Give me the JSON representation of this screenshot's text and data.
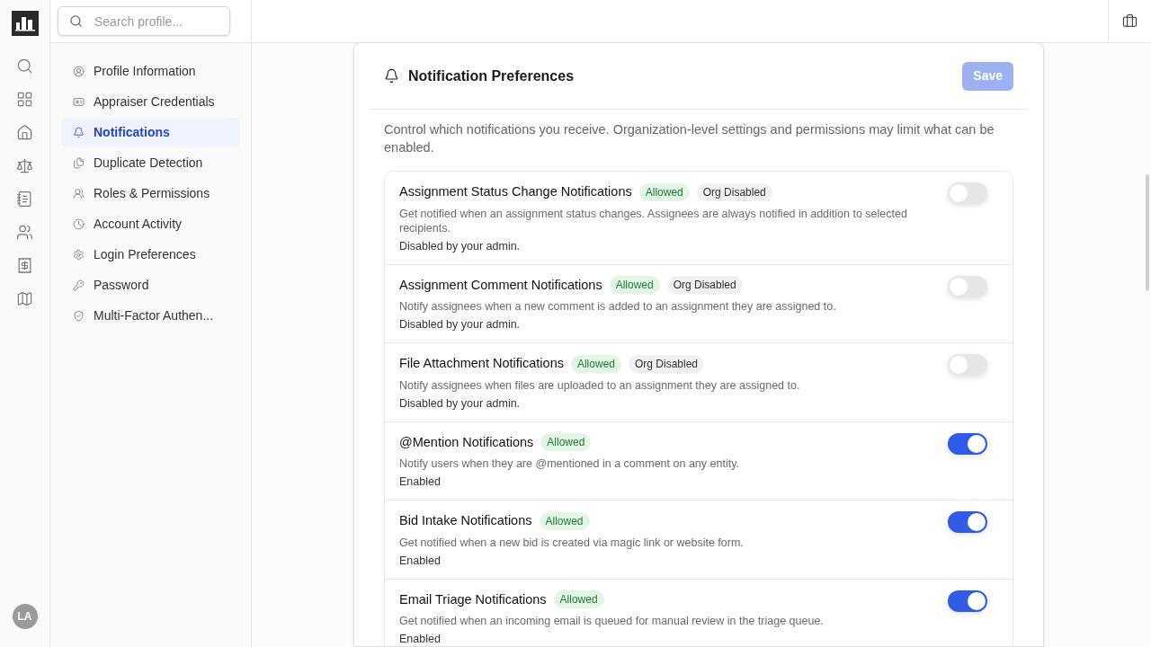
{
  "search": {
    "placeholder": "Search profile..."
  },
  "avatar": {
    "initials": "LA"
  },
  "nav": [
    {
      "label": "Profile Information",
      "selected": false
    },
    {
      "label": "Appraiser Credentials",
      "selected": false
    },
    {
      "label": "Notifications",
      "selected": true
    },
    {
      "label": "Duplicate Detection",
      "selected": false
    },
    {
      "label": "Roles & Permissions",
      "selected": false
    },
    {
      "label": "Account Activity",
      "selected": false
    },
    {
      "label": "Login Preferences",
      "selected": false
    },
    {
      "label": "Password",
      "selected": false
    },
    {
      "label": "Multi-Factor Authen...",
      "selected": false
    }
  ],
  "panel": {
    "title": "Notification Preferences",
    "save": {
      "label": "Save",
      "disabled": true
    },
    "description": "Control which notifications you receive. Organization-level settings and permissions may limit what can be enabled.",
    "settings": [
      {
        "title": "Assignment Status Change Notifications",
        "badges": [
          {
            "label": "Allowed",
            "kind": "allowed"
          },
          {
            "label": "Org Disabled",
            "kind": "org_disabled"
          }
        ],
        "description": "Get notified when an assignment status changes. Assignees are always notified in addition to selected recipients.",
        "status": "Disabled by your admin.",
        "on": false
      },
      {
        "title": "Assignment Comment Notifications",
        "badges": [
          {
            "label": "Allowed",
            "kind": "allowed"
          },
          {
            "label": "Org Disabled",
            "kind": "org_disabled"
          }
        ],
        "description": "Notify assignees when a new comment is added to an assignment they are assigned to.",
        "status": "Disabled by your admin.",
        "on": false
      },
      {
        "title": "File Attachment Notifications",
        "badges": [
          {
            "label": "Allowed",
            "kind": "allowed"
          },
          {
            "label": "Org Disabled",
            "kind": "org_disabled"
          }
        ],
        "description": "Notify assignees when files are uploaded to an assignment they are assigned to.",
        "status": "Disabled by your admin.",
        "on": false
      },
      {
        "title": "@Mention Notifications",
        "badges": [
          {
            "label": "Allowed",
            "kind": "allowed"
          }
        ],
        "description": "Notify users when they are @mentioned in a comment on any entity.",
        "status": "Enabled",
        "on": true
      },
      {
        "title": "Bid Intake Notifications",
        "badges": [
          {
            "label": "Allowed",
            "kind": "allowed"
          }
        ],
        "description": "Get notified when a new bid is created via magic link or website form.",
        "status": "Enabled",
        "on": true
      },
      {
        "title": "Email Triage Notifications",
        "badges": [
          {
            "label": "Allowed",
            "kind": "allowed"
          }
        ],
        "description": "Get notified when an incoming email is queued for manual review in the triage queue.",
        "status": "Enabled",
        "on": true
      }
    ]
  }
}
